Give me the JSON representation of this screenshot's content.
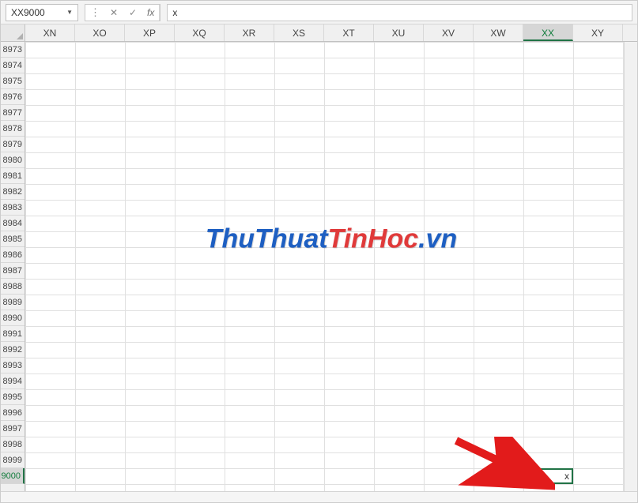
{
  "formula_bar": {
    "name_box_value": "XX9000",
    "fx_label": "fx",
    "formula_value": "x"
  },
  "columns": [
    "XN",
    "XO",
    "XP",
    "XQ",
    "XR",
    "XS",
    "XT",
    "XU",
    "XV",
    "XW",
    "XX",
    "XY"
  ],
  "active_column": "XX",
  "rows": [
    8973,
    8974,
    8975,
    8976,
    8977,
    8978,
    8979,
    8980,
    8981,
    8982,
    8983,
    8984,
    8985,
    8986,
    8987,
    8988,
    8989,
    8990,
    8991,
    8992,
    8993,
    8994,
    8995,
    8996,
    8997,
    8998,
    8999,
    9000
  ],
  "active_row": 9000,
  "active_cell": {
    "col_index": 10,
    "row_index": 27,
    "value": "x"
  },
  "watermark": {
    "part1": "ThuThuat",
    "part2": "TinHoc",
    "part3": ".vn"
  }
}
